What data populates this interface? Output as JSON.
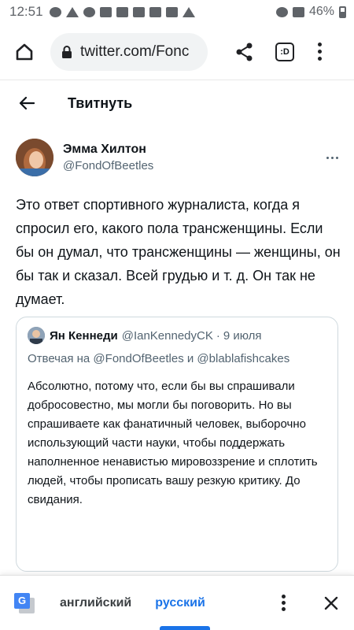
{
  "status_bar": {
    "time": "12:51",
    "battery": "46%",
    "left_icons": [
      "messenger-icon",
      "telegram-icon",
      "google-icon",
      "gallery-icon",
      "shield-icon",
      "key-icon",
      "youtube-icon",
      "youtube-icon",
      "download-icon"
    ],
    "right_icons": [
      "alarm-icon",
      "signal-icon",
      "battery-icon"
    ]
  },
  "browser": {
    "url": "twitter.com/Fonc",
    "tabs_label": ":D"
  },
  "header": {
    "title": "Твитнуть"
  },
  "tweet": {
    "author_name": "Эмма Хилтон",
    "author_handle": "@FondOfBeetles",
    "text": "Это ответ спортивного журналиста, когда я спросил его, какого пола трансженщины. Если бы он думал, что трансженщины — женщины, он бы так и сказал. Всей грудью и т. д. Он так не думает."
  },
  "quote": {
    "author_name": "Ян Кеннеди",
    "author_handle": "@IanKennedyCK",
    "separator": "·",
    "date": "9 июля",
    "reply_to": "Отвечая на @FondOfBeetles и @blablafishcakes",
    "text": "Абсолютно, потому что, если бы вы спрашивали добросовестно, мы могли бы поговорить. Но вы спрашиваете как фанатичный человек, выборочно использующий части науки, чтобы поддержать наполненное ненавистью мировоззрение и сплотить людей, чтобы прописать вашу резкую критику. До свидания."
  },
  "translate_bar": {
    "source_language": "английский",
    "target_language": "русский",
    "accent_color": "#1a73e8"
  }
}
